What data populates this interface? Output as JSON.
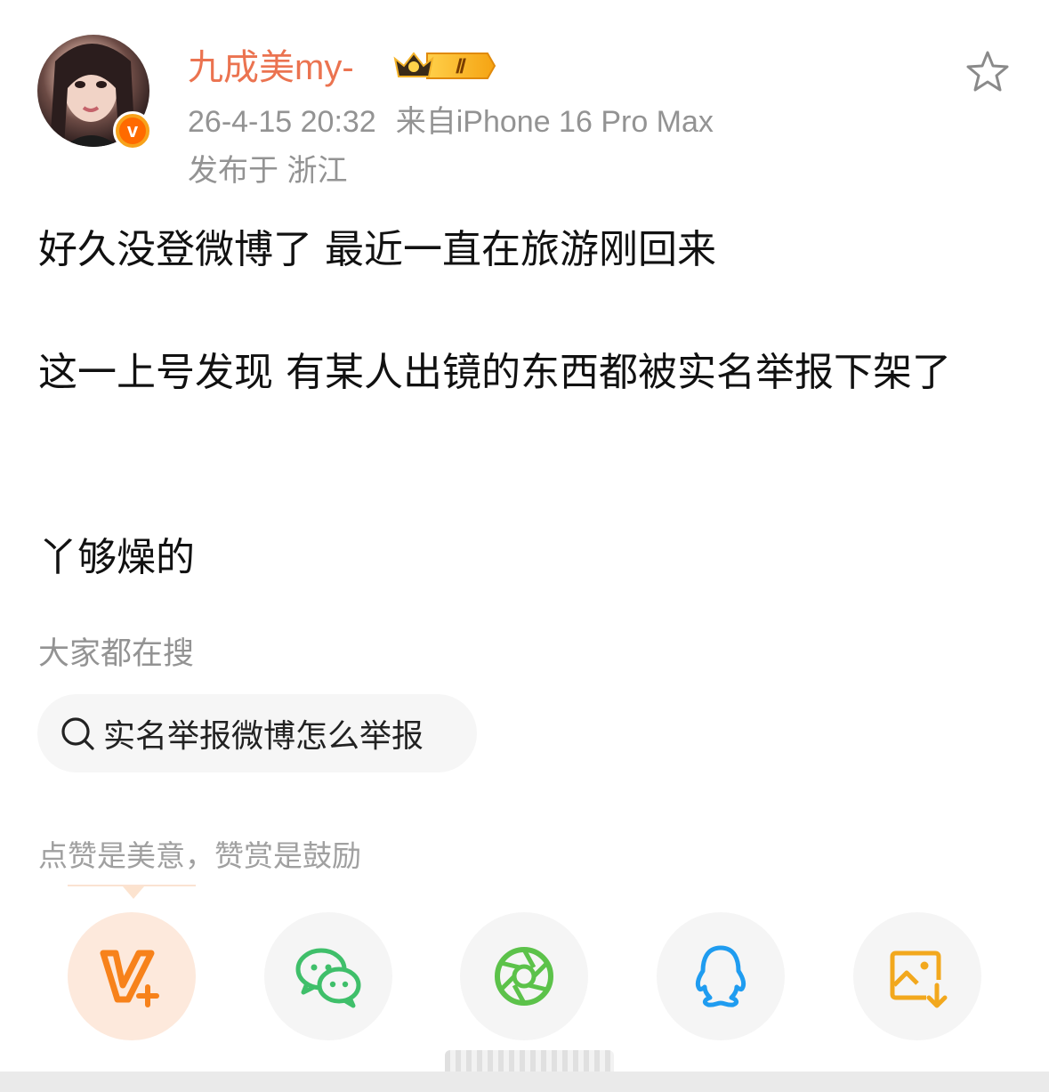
{
  "post": {
    "author": {
      "name": "九成美my-",
      "badge_level": "Ⅱ"
    },
    "timestamp": "26-4-15 20:32",
    "source": "来自iPhone 16 Pro Max",
    "location": "发布于 浙江",
    "paragraphs": [
      "好久没登微博了 最近一直在旅游刚回来",
      "这一上号发现 有某人出镜的东西都被实名举报下架了",
      "丫够燥的"
    ]
  },
  "trending": {
    "label": "大家都在搜",
    "query": "实名举报微博怎么举报"
  },
  "reward": {
    "label": "点赞是美意，赞赏是鼓励"
  },
  "share": {
    "items": [
      {
        "icon": "v-plus-icon",
        "color": "#f7821b"
      },
      {
        "icon": "wechat-icon",
        "color": "#3fbf6a"
      },
      {
        "icon": "moments-icon",
        "color": "#5cc24a"
      },
      {
        "icon": "qq-icon",
        "color": "#1f9cf0"
      },
      {
        "icon": "save-image-icon",
        "color": "#f2a81d"
      }
    ]
  },
  "colors": {
    "username": "#eb7350",
    "meta": "#939393"
  }
}
